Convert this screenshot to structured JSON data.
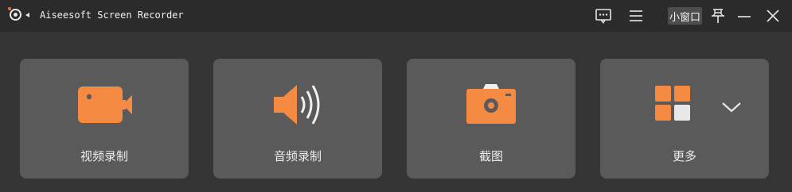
{
  "window": {
    "title": "Aiseesoft Screen Recorder",
    "mini_window_label": "小窗口"
  },
  "icons": {
    "logo": "record-logo-icon",
    "feedback": "chat-bubble-icon",
    "menu": "hamburger-menu-icon",
    "pin": "pin-icon",
    "minimize": "minimize-icon",
    "close": "close-icon",
    "video": "video-camera-icon",
    "audio": "speaker-icon",
    "snapshot": "camera-icon",
    "more": "grid-icon",
    "expand": "chevron-down-icon"
  },
  "cards": [
    {
      "label": "视频录制"
    },
    {
      "label": "音频录制"
    },
    {
      "label": "截图"
    },
    {
      "label": "更多"
    }
  ],
  "colors": {
    "accent": "#f58a42",
    "card_bg": "#5a5a5a",
    "window_bg": "#353535",
    "titlebar_bg": "#2b2b2b"
  }
}
